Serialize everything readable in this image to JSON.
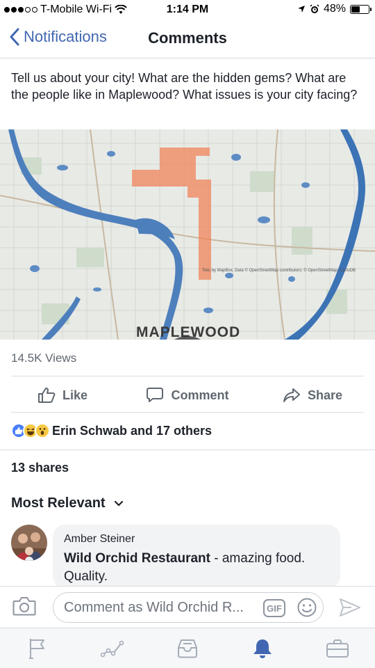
{
  "status_bar": {
    "carrier": "T-Mobile Wi-Fi",
    "time": "1:14 PM",
    "battery": "48%",
    "battery_level": 0.48
  },
  "nav": {
    "back_label": "Notifications",
    "title": "Comments"
  },
  "post": {
    "text": "Tell us about your city! What are the hidden gems? What are the people like in Maplewood? What issues is your city facing?",
    "video_map_label": "MAPLEWOOD",
    "video_attribution": "Tiles by MapBox, Data © OpenStreetMap contributors; © OpenStreetMap; CartoDB",
    "views": "14.5K Views"
  },
  "actions": {
    "like": "Like",
    "comment": "Comment",
    "share": "Share"
  },
  "reactions": {
    "summary": "Erin Schwab and 17 others",
    "types": [
      "like",
      "haha",
      "wow"
    ]
  },
  "shares": "13 shares",
  "sort": {
    "label": "Most Relevant"
  },
  "comment": {
    "author": "Amber Steiner",
    "tag": "Wild Orchid Restaurant",
    "text": " - amazing food. Quality."
  },
  "composer": {
    "placeholder": "Comment as Wild Orchid R...",
    "gif_label": "GIF"
  },
  "tabbar": {
    "items": [
      "flag-icon",
      "activity-icon",
      "inbox-icon",
      "notifications-icon",
      "briefcase-icon"
    ],
    "active": "notifications-icon",
    "active_color": "#4267b2",
    "inactive_color": "#a5adb8"
  }
}
